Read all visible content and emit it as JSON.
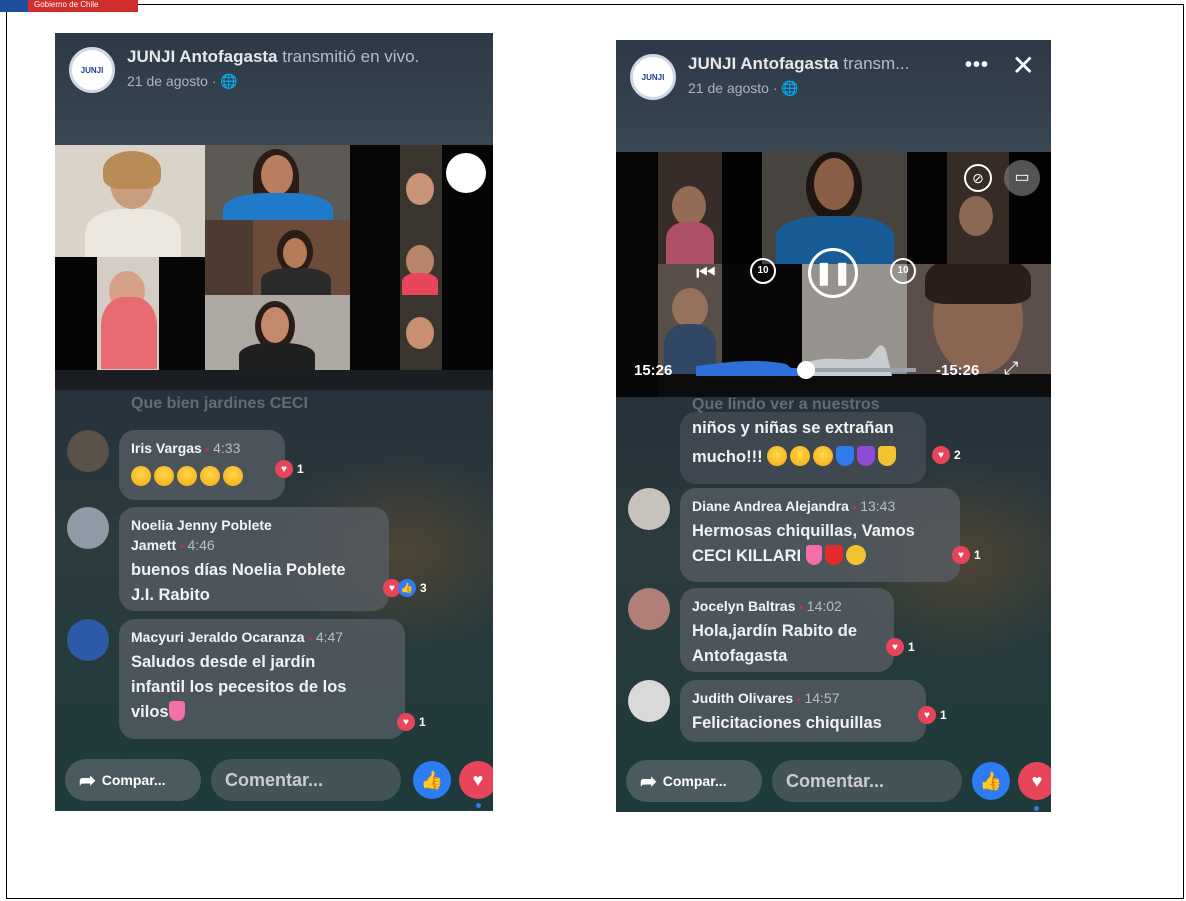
{
  "phones": [
    {
      "header": {
        "avatar_text": "JUNJI",
        "title": "JUNJI Antofagasta",
        "title_suffix": "transmitió en vivo.",
        "date": "21 de agosto ·"
      },
      "faded_comment": "Que bien jardines CECI",
      "comments": [
        {
          "name": "Iris Vargas",
          "time": "4:33",
          "text": "",
          "emojis": 5,
          "reactions": {
            "count": "1"
          }
        },
        {
          "name": "Noelia Jenny Poblete",
          "name2": "Jamett",
          "time": "4:46",
          "text": "buenos días Noelia Poblete",
          "text2": "J.I. Rabito",
          "reactions": {
            "count": "3"
          }
        },
        {
          "name": "Macyuri Jeraldo Ocaranza",
          "time": "4:47",
          "text": "Saludos desde el jardín",
          "text2": "infantil los pecesitos de los",
          "text3": "vilos",
          "reactions": {
            "count": "1"
          }
        }
      ],
      "bottom": {
        "share": "Compar...",
        "comment": "Comentar..."
      }
    },
    {
      "header": {
        "avatar_text": "JUNJI",
        "title": "JUNJI Antofagasta",
        "title_suffix": "transm...",
        "date": "21 de agosto ·",
        "more": "•••",
        "close": "✕"
      },
      "player": {
        "elapsed": "15:26",
        "remaining": "-15:26",
        "progress": 0.46
      },
      "faded_comment": "Que lindo ver a nuestros",
      "comments": [
        {
          "text": "niños y niñas se extrañan",
          "text2": "mucho!!!",
          "reactions": {
            "count": "2"
          }
        },
        {
          "name": "Diane Andrea Alejandra",
          "time": "13:43",
          "text": "Hermosas chiquillas, Vamos",
          "text2": "CECI KILLARI",
          "reactions": {
            "count": "1"
          }
        },
        {
          "name": "Jocelyn Baltras",
          "time": "14:02",
          "text": "Hola,jardín Rabito de",
          "text2": "Antofagasta",
          "reactions": {
            "count": "1"
          }
        },
        {
          "name": "Judith Olivares",
          "time": "14:57",
          "text": "Felicitaciones  chiquillas",
          "reactions": {
            "count": "1"
          }
        }
      ],
      "bottom": {
        "share": "Compar...",
        "comment": "Comentar..."
      }
    }
  ],
  "gov_badge": "Gobierno de Chile"
}
